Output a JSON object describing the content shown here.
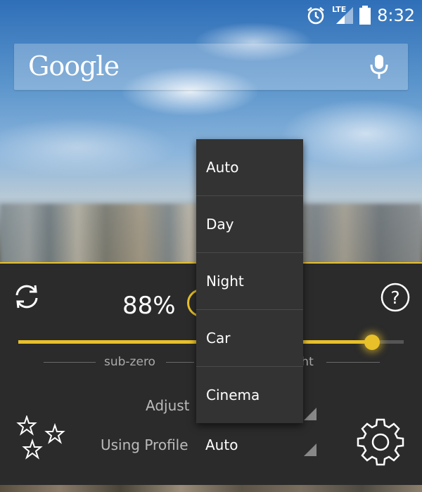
{
  "status_bar": {
    "time": "8:32",
    "network": "LTE",
    "icons": [
      "alarm-icon",
      "signal-icon",
      "battery-icon"
    ]
  },
  "search": {
    "logo": "Google",
    "icons": [
      "mic-icon"
    ]
  },
  "widget": {
    "brightness_percent_label": "88%",
    "brightness_level": 0.92,
    "scale_labels": [
      "sub-zero",
      "bright"
    ],
    "adjust_label": "Adjust",
    "profile_label": "Using Profile",
    "profile_value": "Auto",
    "accent_color": "#e8c02a",
    "icons": [
      "refresh-icon",
      "help-icon",
      "sun-icon",
      "stars-icon",
      "gear-icon"
    ]
  },
  "dropdown": {
    "options": [
      "Auto",
      "Day",
      "Night",
      "Car",
      "Cinema"
    ]
  }
}
